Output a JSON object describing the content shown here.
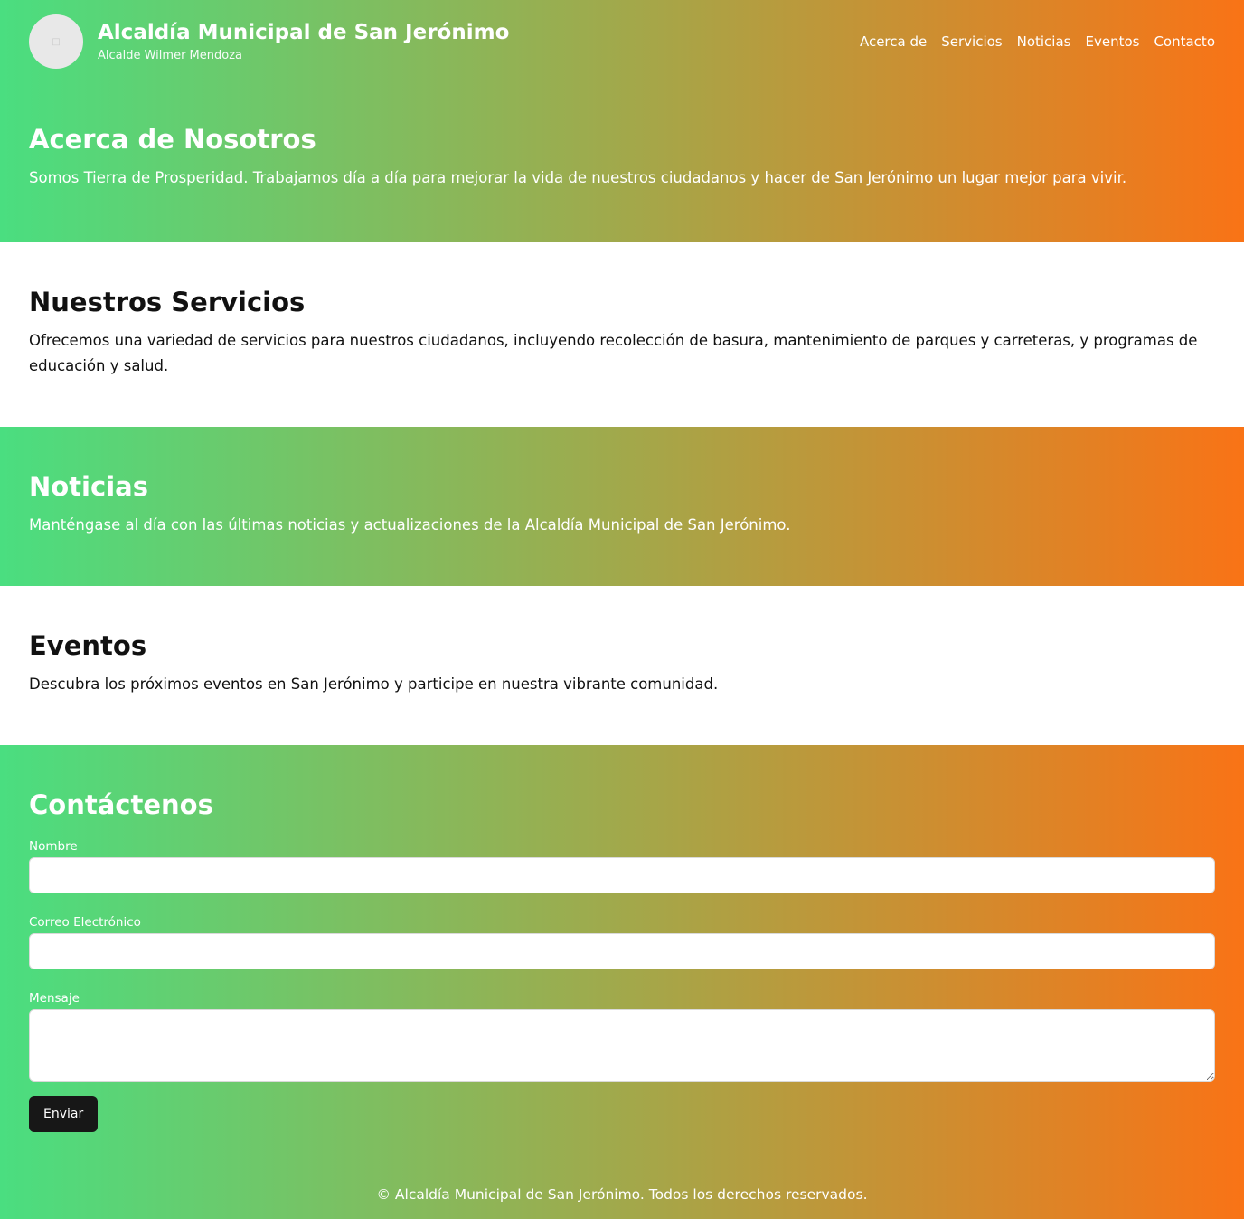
{
  "header": {
    "logo_icon": "placeholder-image-icon",
    "title": "Alcaldía Municipal de San Jerónimo",
    "subtitle": "Alcalde Wilmer Mendoza",
    "nav": [
      "Acerca de",
      "Servicios",
      "Noticias",
      "Eventos",
      "Contacto"
    ]
  },
  "about": {
    "title": "Acerca de Nosotros",
    "text": "Somos Tierra de Prosperidad. Trabajamos día a día para mejorar la vida de nuestros ciudadanos y hacer de San Jerónimo un lugar mejor para vivir."
  },
  "services": {
    "title": "Nuestros Servicios",
    "text": "Ofrecemos una variedad de servicios para nuestros ciudadanos, incluyendo recolección de basura, mantenimiento de parques y carreteras, y programas de educación y salud."
  },
  "news": {
    "title": "Noticias",
    "text": "Manténgase al día con las últimas noticias y actualizaciones de la Alcaldía Municipal de San Jerónimo."
  },
  "events": {
    "title": "Eventos",
    "text": "Descubra los próximos eventos en San Jerónimo y participe en nuestra vibrante comunidad."
  },
  "contact": {
    "title": "Contáctenos",
    "name_label": "Nombre",
    "name_value": "",
    "email_label": "Correo Electrónico",
    "email_value": "",
    "message_label": "Mensaje",
    "message_value": "",
    "submit_label": "Enviar"
  },
  "footer": {
    "text": "© Alcaldía Municipal de San Jerónimo. Todos los derechos reservados."
  },
  "colors": {
    "gradient_start": "#4ade80",
    "gradient_end": "#f97316",
    "button": "#171717"
  }
}
